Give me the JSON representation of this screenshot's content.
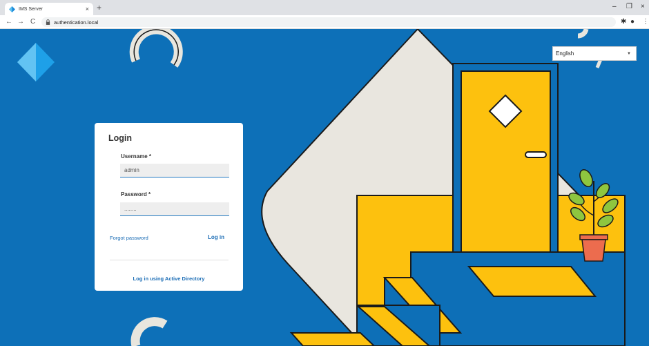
{
  "browser": {
    "tab_title": "IMS Server",
    "tab_close": "×",
    "new_tab": "+",
    "url": "authentication.local",
    "back": "←",
    "forward": "→",
    "reload": "C",
    "minimize": "–",
    "restore": "❐",
    "close": "×",
    "extensions": "✱",
    "profile": "●",
    "menu": "⋮"
  },
  "language": {
    "selected": "English",
    "caret": "▼"
  },
  "login": {
    "title": "Login",
    "username_label": "Username *",
    "username_value": "admin",
    "password_label": "Password *",
    "password_value": "........",
    "forgot_password": "Forgot password",
    "login_button": "Log in",
    "ad_link": "Log in using Active Directory"
  },
  "colors": {
    "background": "#0d70b8",
    "accent": "#1a6cb5",
    "door": "#fdc10e"
  }
}
